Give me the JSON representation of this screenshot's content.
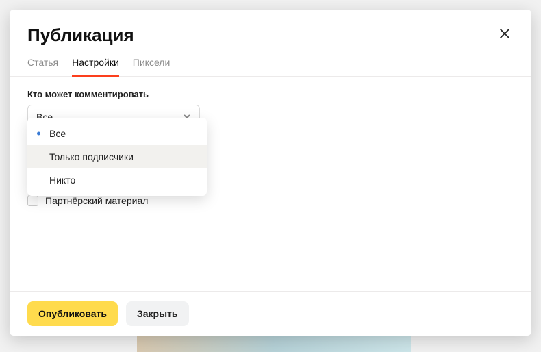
{
  "modal": {
    "title": "Публикация",
    "tabs": [
      {
        "label": "Статья",
        "active": false
      },
      {
        "label": "Настройки",
        "active": true
      },
      {
        "label": "Пиксели",
        "active": false
      }
    ],
    "comment_field": {
      "label": "Кто может комментировать",
      "selected": "Все",
      "options": [
        {
          "label": "Все",
          "selected": true,
          "hover": false
        },
        {
          "label": "Только подписчики",
          "selected": false,
          "hover": true
        },
        {
          "label": "Никто",
          "selected": false,
          "hover": false
        }
      ]
    },
    "partner_checkbox": {
      "label": "Партнёрский материал",
      "checked": false
    },
    "buttons": {
      "publish": "Опубликовать",
      "close": "Закрыть"
    }
  }
}
